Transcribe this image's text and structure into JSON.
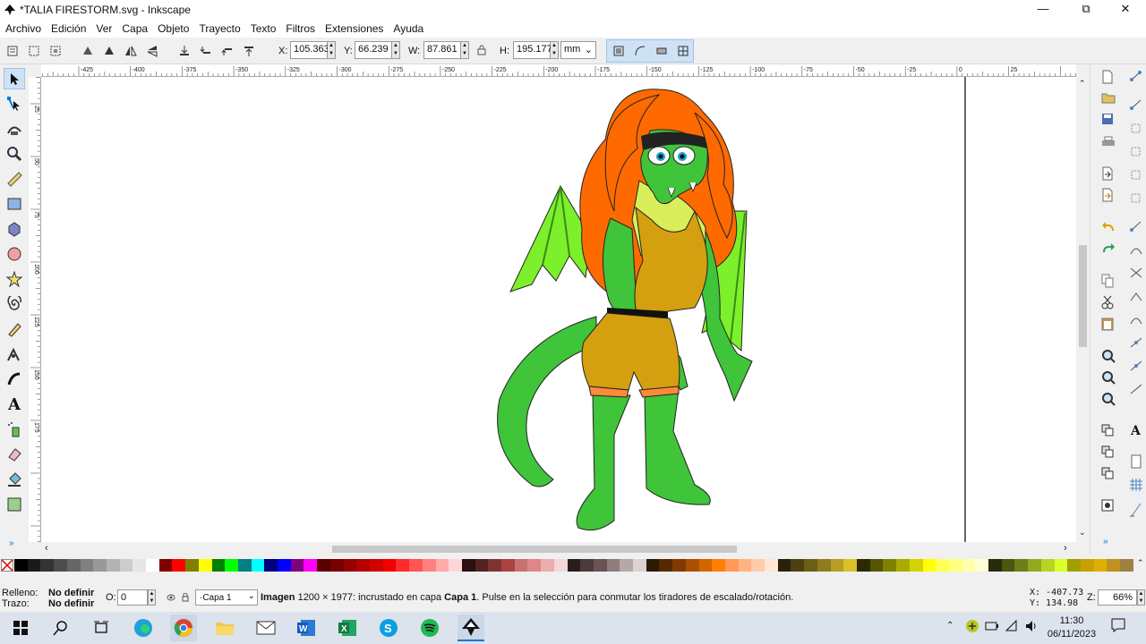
{
  "window": {
    "title": "*TALIA FIRESTORM.svg - Inkscape",
    "minimize": "—",
    "restore": "⧉",
    "close": "✕"
  },
  "menu": [
    "Archivo",
    "Edición",
    "Ver",
    "Capa",
    "Objeto",
    "Trayecto",
    "Texto",
    "Filtros",
    "Extensiones",
    "Ayuda"
  ],
  "toolbar": {
    "x_label": "X:",
    "x_value": "105.363",
    "y_label": "Y:",
    "y_value": "66.239",
    "w_label": "W:",
    "w_value": "87.861",
    "h_label": "H:",
    "h_value": "195.177",
    "unit": "mm"
  },
  "ruler": {
    "top_ticks": [
      "-425",
      "-400",
      "-375",
      "-350",
      "-325",
      "-300",
      "-275",
      "-250",
      "-225",
      "-200",
      "-175",
      "-150",
      "-125",
      "-100",
      "-75",
      "-50",
      "-25",
      "0",
      "25"
    ],
    "left_ticks": [
      "25",
      "50",
      "75",
      "100",
      "125",
      "150",
      "175"
    ]
  },
  "statusbar": {
    "fill_label": "Relleno:",
    "fill_value": "No definir",
    "stroke_label": "Trazo:",
    "stroke_value": "No definir",
    "opacity_label": "O:",
    "opacity_value": "0",
    "layer": "·Capa 1",
    "msg_strong": "Imagen",
    "msg_text": " 1200 × 1977: incrustado en capa ",
    "msg_layer": "Capa 1",
    "msg_tail": ". Pulse en la selección para conmutar los tiradores de escalado/rotación.",
    "cursor_x": "X: -407.73",
    "cursor_y": "Y: 134.98",
    "zoom_label": "Z:",
    "zoom_value": "66%"
  },
  "taskbar": {
    "time": "11:30",
    "date": "06/11/2023"
  },
  "palette": [
    "#000000",
    "#1a1a1a",
    "#333333",
    "#4d4d4d",
    "#666666",
    "#808080",
    "#999999",
    "#b3b3b3",
    "#cccccc",
    "#e6e6e6",
    "#ffffff",
    "#800000",
    "#ff0000",
    "#808000",
    "#ffff00",
    "#008000",
    "#00ff00",
    "#008080",
    "#00ffff",
    "#000080",
    "#0000ff",
    "#800080",
    "#ff00ff",
    "#5a0000",
    "#780000",
    "#960000",
    "#b40000",
    "#d20000",
    "#f00000",
    "#ff2a2a",
    "#ff5555",
    "#ff8080",
    "#ffaaaa",
    "#ffd5d5",
    "#2b1111",
    "#552222",
    "#803333",
    "#aa4444",
    "#c87171",
    "#de8787",
    "#e9afaf",
    "#f4d7d7",
    "#281e1e",
    "#4d3a3a",
    "#6c5353",
    "#917c7c",
    "#b7a8a8",
    "#dbd3d3",
    "#2b1a00",
    "#552a00",
    "#803c00",
    "#aa5000",
    "#d46400",
    "#ff7f00",
    "#ff9955",
    "#ffb380",
    "#ffccaa",
    "#ffe6d5",
    "#28220b",
    "#4d4011",
    "#6c5d17",
    "#917c1d",
    "#b79f24",
    "#dbc02a",
    "#2b2b00",
    "#555500",
    "#808000",
    "#aaaa00",
    "#d4d400",
    "#ffff00",
    "#ffff55",
    "#ffff80",
    "#ffffaa",
    "#ffffd5",
    "#282b0b",
    "#4d5511",
    "#6c8017",
    "#91aa1d",
    "#b7d424",
    "#dbff2a",
    "#a0a000",
    "#c8a000",
    "#e0b000",
    "#c09020",
    "#a08040"
  ],
  "colors": {
    "accent": "#0078d7",
    "hair": "#ff6a00",
    "skin": "#3fc43a",
    "outfit": "#d4a010",
    "wing": "#7cf02a"
  }
}
